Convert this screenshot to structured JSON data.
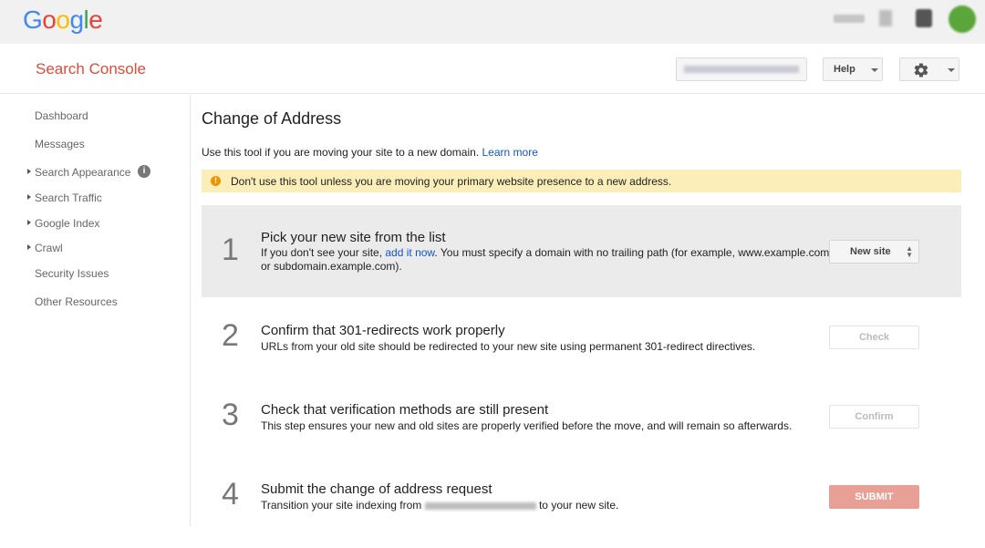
{
  "topbar": {
    "logo_letters": [
      {
        "char": "G",
        "color": "#4285f4"
      },
      {
        "char": "o",
        "color": "#ea4335"
      },
      {
        "char": "o",
        "color": "#fbbc05"
      },
      {
        "char": "g",
        "color": "#4285f4"
      },
      {
        "char": "l",
        "color": "#34a853"
      },
      {
        "char": "e",
        "color": "#ea4335"
      }
    ]
  },
  "header": {
    "product_title": "Search Console",
    "help_label": "Help"
  },
  "sidebar": {
    "items": [
      {
        "label": "Dashboard",
        "expandable": false
      },
      {
        "label": "Messages",
        "expandable": false
      },
      {
        "label": "Search Appearance",
        "expandable": true
      },
      {
        "label": "Search Traffic",
        "expandable": true
      },
      {
        "label": "Google Index",
        "expandable": true
      },
      {
        "label": "Crawl",
        "expandable": true
      },
      {
        "label": "Security Issues",
        "expandable": false
      },
      {
        "label": "Other Resources",
        "expandable": false
      }
    ],
    "info_icon": "i"
  },
  "main": {
    "title": "Change of Address",
    "intro_text": "Use this tool if you are moving your site to a new domain.",
    "intro_link": "Learn more",
    "warning_icon": "!",
    "warning_text": "Don't use this tool unless you are moving your primary website presence to a new address.",
    "steps": [
      {
        "number": "1",
        "title": "Pick your new site from the list",
        "desc_before": "If you don't see your site, ",
        "desc_link": "add it now",
        "desc_after": ". You must specify a domain with no trailing path (for example, www.example.com or subdomain.example.com).",
        "button": "New site"
      },
      {
        "number": "2",
        "title": "Confirm that 301-redirects work properly",
        "desc": "URLs from your old site should be redirected to your new site using permanent 301-redirect directives.",
        "button": "Check"
      },
      {
        "number": "3",
        "title": "Check that verification methods are still present",
        "desc": "This step ensures your new and old sites are properly verified before the move, and will remain so afterwards.",
        "button": "Confirm"
      },
      {
        "number": "4",
        "title": "Submit the change of address request",
        "desc_before": "Transition your site indexing from ",
        "desc_after": " to your new site.",
        "button": "SUBMIT"
      }
    ]
  }
}
